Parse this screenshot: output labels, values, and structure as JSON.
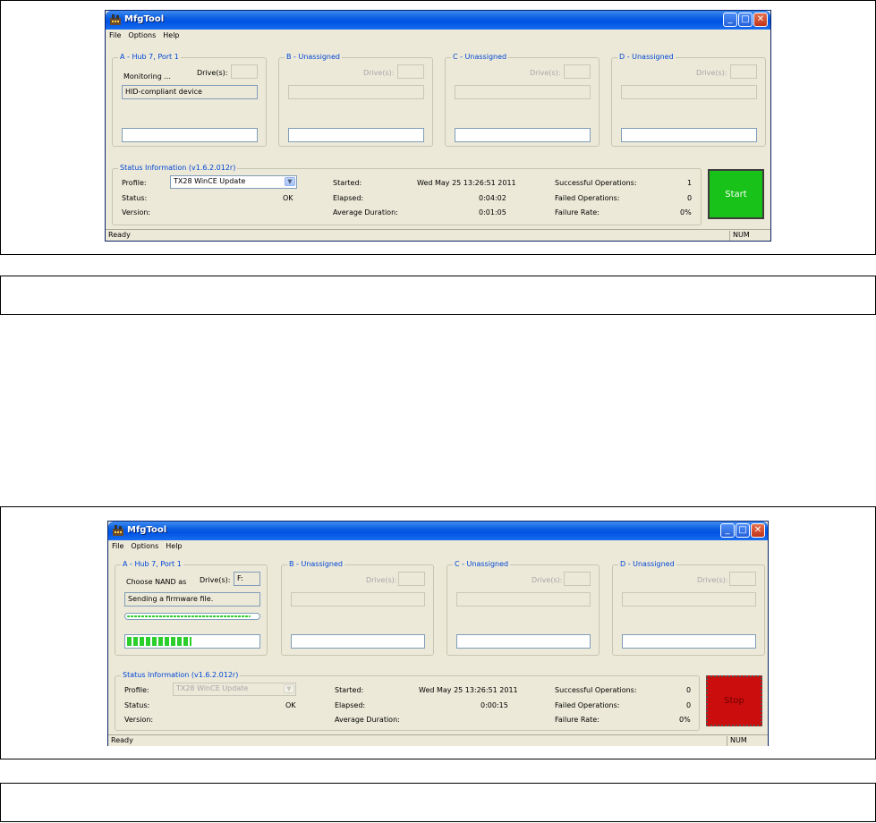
{
  "colors": {
    "start_green": "#19c219",
    "stop_red": "#cc0d0d",
    "title_blue": "#0054e3",
    "group_label_blue": "#0046d5"
  },
  "screens": [
    {
      "title": "MfgTool",
      "menu": [
        "File",
        "Options",
        "Help"
      ],
      "panels": [
        {
          "label": "A - Hub 7, Port 1",
          "drives_label": "Drive(s):",
          "drives_value": "",
          "status_text": "Monitoring ...",
          "device_field": "HID-compliant device",
          "progress": 0
        },
        {
          "label": "B - Unassigned",
          "drives_label": "Drive(s):",
          "drives_value": "",
          "status_text": "",
          "device_field": "",
          "progress": 0
        },
        {
          "label": "C - Unassigned",
          "drives_label": "Drive(s):",
          "drives_value": "",
          "status_text": "",
          "device_field": "",
          "progress": 0
        },
        {
          "label": "D - Unassigned",
          "drives_label": "Drive(s):",
          "drives_value": "",
          "status_text": "",
          "device_field": "",
          "progress": 0
        }
      ],
      "status_info": {
        "label": "Status Information (v1.6.2.012r)",
        "profile_label": "Profile:",
        "profile_value": "TX28 WinCE Update",
        "status_label": "Status:",
        "status_value": "OK",
        "version_label": "Version:",
        "started_label": "Started:",
        "started_value": "Wed May 25 13:26:51 2011",
        "elapsed_label": "Elapsed:",
        "elapsed_value": "0:04:02",
        "avg_label": "Average Duration:",
        "avg_value": "0:01:05",
        "success_label": "Successful Operations:",
        "success_value": "1",
        "failed_label": "Failed Operations:",
        "failed_value": "0",
        "rate_label": "Failure Rate:",
        "rate_value": "0%"
      },
      "action_button": "Start",
      "statusbar_text": "Ready",
      "statusbar_num": "NUM"
    },
    {
      "title": "MfgTool",
      "menu": [
        "File",
        "Options",
        "Help"
      ],
      "panels": [
        {
          "label": "A - Hub 7, Port 1",
          "drives_label": "Drive(s):",
          "drives_value": "F:",
          "status_text": "Choose NAND as",
          "device_field": "Sending a firmware file.",
          "progress_task": 1.0,
          "progress": 0.5
        },
        {
          "label": "B - Unassigned",
          "drives_label": "Drive(s):",
          "drives_value": "",
          "status_text": "",
          "device_field": "",
          "progress": 0
        },
        {
          "label": "C - Unassigned",
          "drives_label": "Drive(s):",
          "drives_value": "",
          "status_text": "",
          "device_field": "",
          "progress": 0
        },
        {
          "label": "D - Unassigned",
          "drives_label": "Drive(s):",
          "drives_value": "",
          "status_text": "",
          "device_field": "",
          "progress": 0
        }
      ],
      "status_info": {
        "label": "Status Information (v1.6.2.012r)",
        "profile_label": "Profile:",
        "profile_value": "TX28 WinCE Update",
        "status_label": "Status:",
        "status_value": "OK",
        "version_label": "Version:",
        "started_label": "Started:",
        "started_value": "Wed May 25 13:26:51 2011",
        "elapsed_label": "Elapsed:",
        "elapsed_value": "0:00:15",
        "avg_label": "Average Duration:",
        "avg_value": "",
        "success_label": "Successful Operations:",
        "success_value": "0",
        "failed_label": "Failed Operations:",
        "failed_value": "0",
        "rate_label": "Failure Rate:",
        "rate_value": "0%"
      },
      "action_button": "Stop",
      "statusbar_text": "Ready",
      "statusbar_num": "NUM"
    }
  ]
}
